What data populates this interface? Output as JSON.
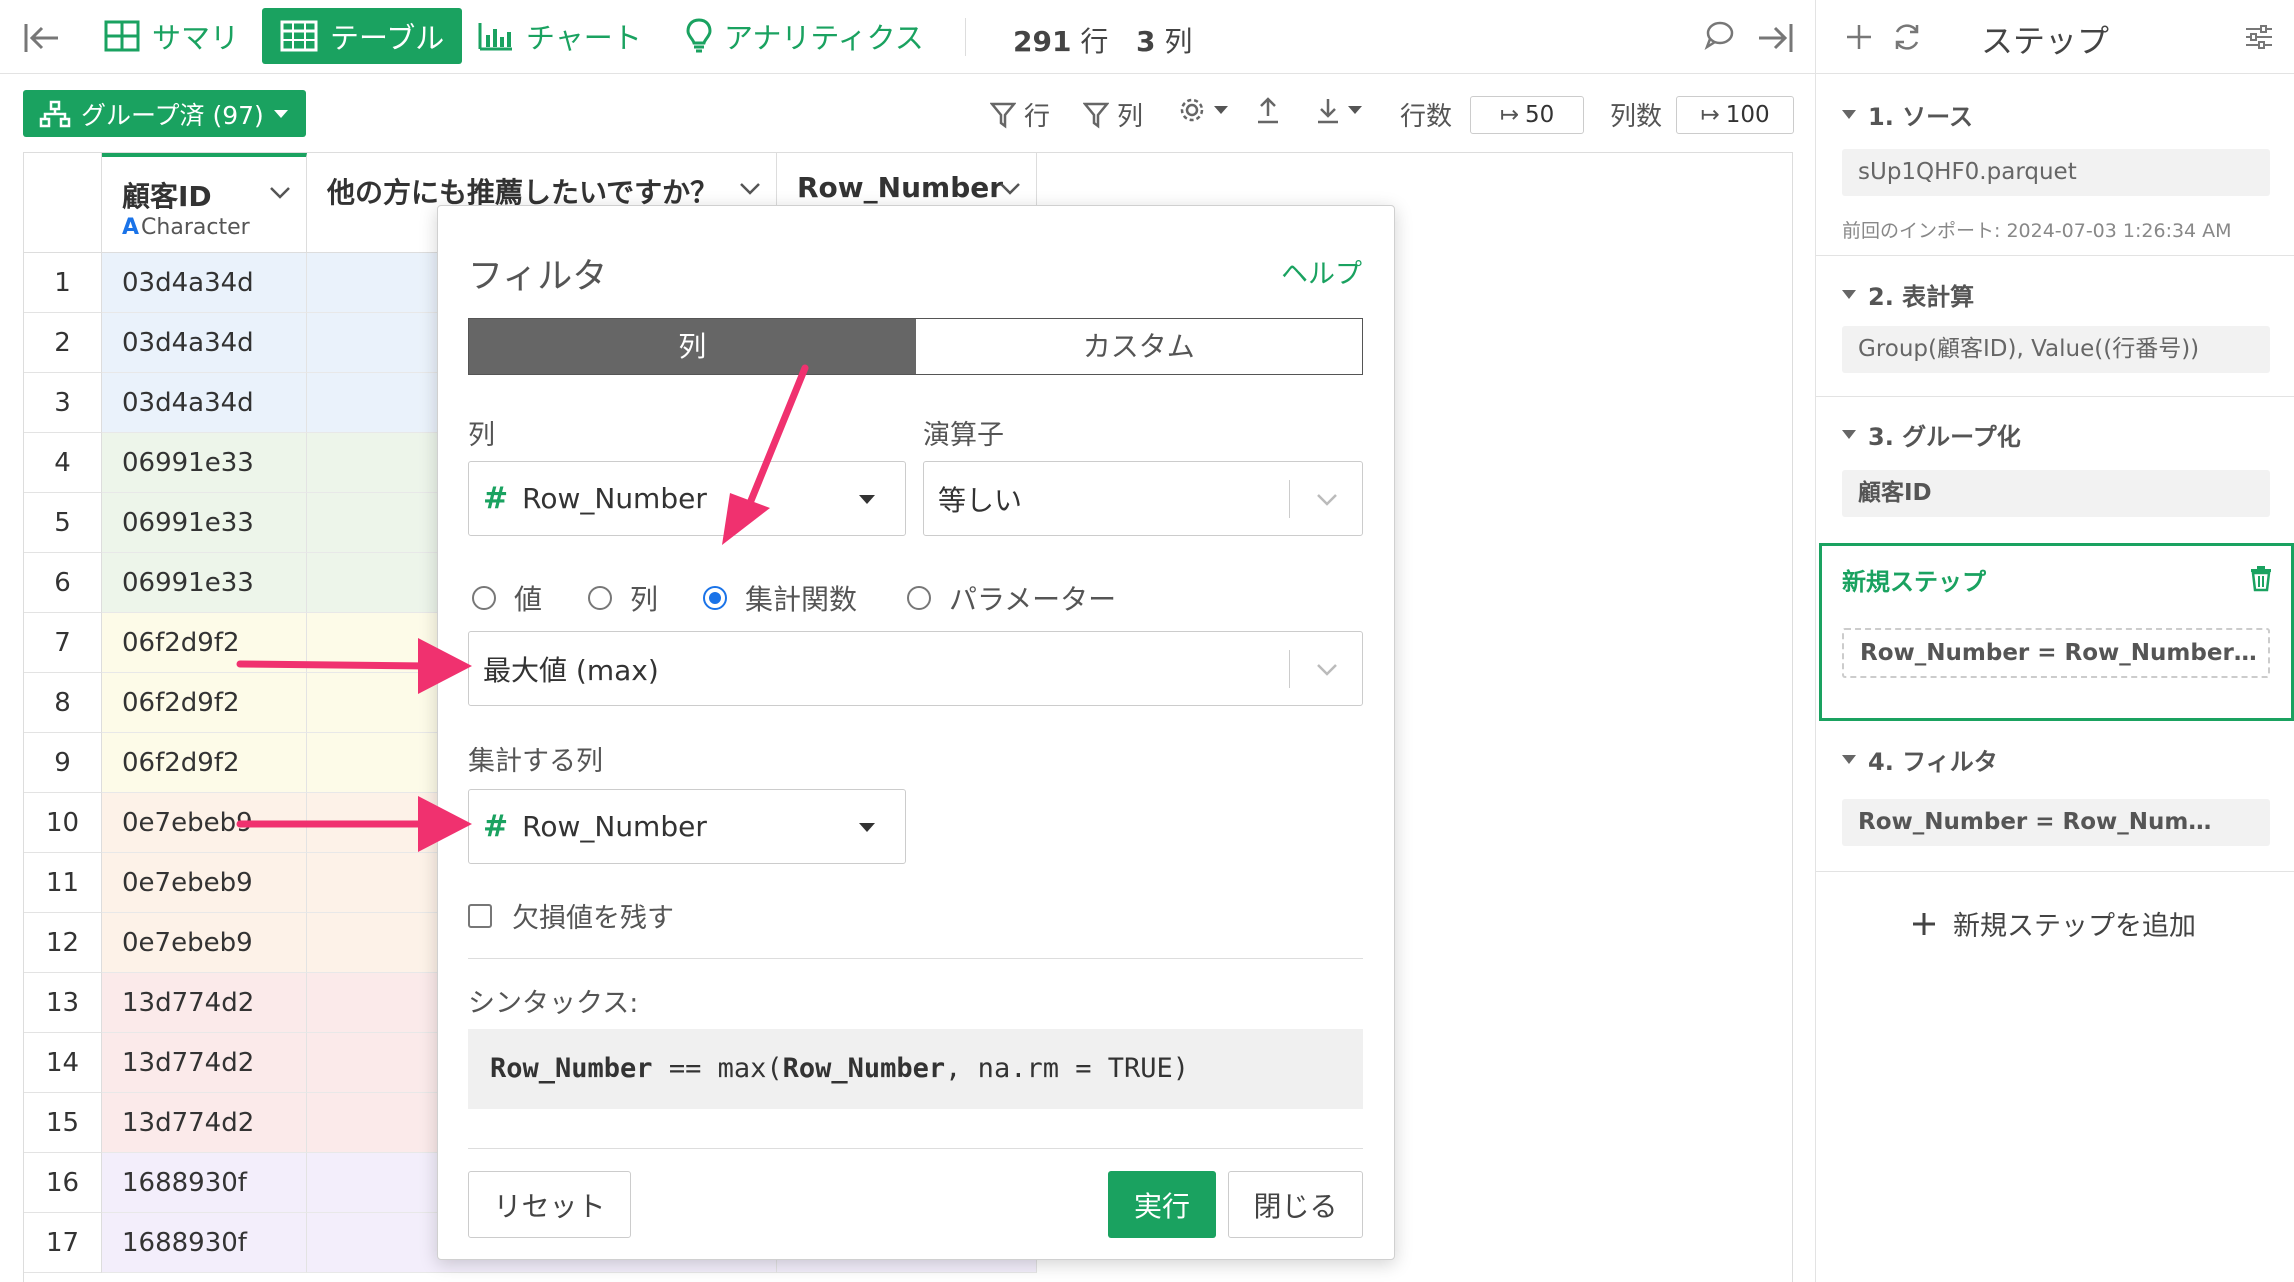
{
  "toolbar": {
    "tabs": [
      {
        "label": "サマリ",
        "icon": "summary-grid-icon"
      },
      {
        "label": "テーブル",
        "icon": "table-icon"
      },
      {
        "label": "チャート",
        "icon": "bar-chart-icon"
      },
      {
        "label": "アナリティクス",
        "icon": "lightbulb-icon"
      }
    ],
    "row_count": "291",
    "row_unit": "行",
    "col_count": "3",
    "col_unit": "列"
  },
  "subtoolbar": {
    "group_label": "グループ済 (97)",
    "row_filter_label": "行",
    "col_filter_label": "列",
    "rows_label": "行数",
    "rows_value": "50",
    "cols_label": "列数",
    "cols_value": "100"
  },
  "table": {
    "columns": [
      {
        "name": "顧客ID",
        "type": "Character"
      },
      {
        "name": "他の方にも推薦したいですか？",
        "type": ""
      },
      {
        "name": "Row_Number",
        "type": ""
      }
    ],
    "rows": [
      {
        "n": "1",
        "id": "03d4a34d",
        "bg": "#eaf2fb"
      },
      {
        "n": "2",
        "id": "03d4a34d",
        "bg": "#eaf2fb"
      },
      {
        "n": "3",
        "id": "03d4a34d",
        "bg": "#eaf2fb"
      },
      {
        "n": "4",
        "id": "06991e33",
        "bg": "#edf5ea"
      },
      {
        "n": "5",
        "id": "06991e33",
        "bg": "#edf5ea"
      },
      {
        "n": "6",
        "id": "06991e33",
        "bg": "#edf5ea"
      },
      {
        "n": "7",
        "id": "06f2d9f2",
        "bg": "#fdfbe8"
      },
      {
        "n": "8",
        "id": "06f2d9f2",
        "bg": "#fdfbe8"
      },
      {
        "n": "9",
        "id": "06f2d9f2",
        "bg": "#fdfbe8"
      },
      {
        "n": "10",
        "id": "0e7ebeb9",
        "bg": "#fdf2e8"
      },
      {
        "n": "11",
        "id": "0e7ebeb9",
        "bg": "#fdf2e8"
      },
      {
        "n": "12",
        "id": "0e7ebeb9",
        "bg": "#fdf2e8"
      },
      {
        "n": "13",
        "id": "13d774d2",
        "bg": "#fbeaea"
      },
      {
        "n": "14",
        "id": "13d774d2",
        "bg": "#fbeaea"
      },
      {
        "n": "15",
        "id": "13d774d2",
        "bg": "#fbeaea"
      },
      {
        "n": "16",
        "id": "1688930f",
        "bg": "#f3eefb"
      },
      {
        "n": "17",
        "id": "1688930f",
        "bg": "#f3eefb"
      }
    ]
  },
  "steps_panel": {
    "title": "ステップ",
    "steps": [
      {
        "title": "1. ソース",
        "value": "sUp1QHF0.parquet",
        "sub": "前回のインポート: 2024-07-03 1:26:34 AM"
      },
      {
        "title": "2. 表計算",
        "value": "Group(顧客ID), Value((行番号))"
      },
      {
        "title": "3. グループ化",
        "value": "顧客ID"
      },
      {
        "title": "4. フィルタ",
        "value": "Row_Number = Row_Num…"
      }
    ],
    "new_step": {
      "title": "新規ステップ",
      "value": "Row_Number = Row_Number…"
    },
    "add_step_label": "新規ステップを追加"
  },
  "filter_dialog": {
    "title": "フィルタ",
    "help": "ヘルプ",
    "tab_column": "列",
    "tab_custom": "カスタム",
    "column_label": "列",
    "column_value": "Row_Number",
    "operator_label": "演算子",
    "operator_value": "等しい",
    "radio_options": [
      "値",
      "列",
      "集計関数",
      "パラメーター"
    ],
    "radio_selected": "集計関数",
    "aggregate_value": "最大値 (max)",
    "agg_column_label": "集計する列",
    "agg_column_value": "Row_Number",
    "keep_na_label": "欠損値を残す",
    "syntax_label": "シンタックス:",
    "syntax_parts": [
      "Row_Number",
      " == max(",
      "Row_Number",
      ", na.rm = TRUE)"
    ],
    "reset_label": "リセット",
    "run_label": "実行",
    "close_label": "閉じる"
  },
  "colors": {
    "accent": "#1aa260",
    "arrow": "#f0316f",
    "radio": "#1a73e8"
  }
}
